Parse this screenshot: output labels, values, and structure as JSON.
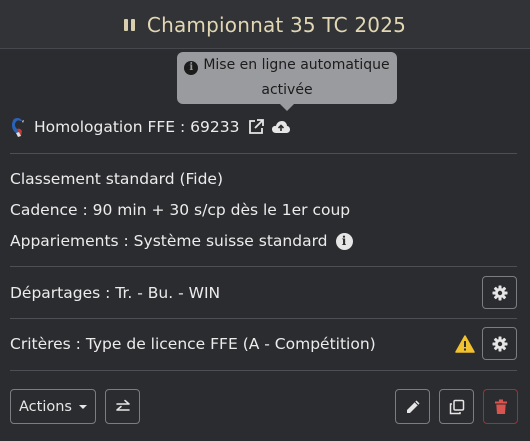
{
  "header": {
    "title": "Championnat 35 TC 2025"
  },
  "tooltip": {
    "text": "Mise en ligne automatique activée"
  },
  "homologation": {
    "label": "Homologation FFE : 69233"
  },
  "details": {
    "classement": "Classement standard (Fide)",
    "cadence": "Cadence : 90 min + 30 s/cp dès le 1er coup",
    "appariements": "Appariements : Système suisse standard"
  },
  "departages": {
    "label": "Départages : Tr. - Bu. - WIN"
  },
  "criteres": {
    "label": "Critères : Type de licence FFE (A - Compétition)"
  },
  "toolbar": {
    "actions_label": "Actions"
  },
  "colors": {
    "title": "#e2d7b3",
    "warning": "#f2c12e",
    "danger": "#d9534f",
    "tooltip_bg": "#9a9b9e"
  }
}
